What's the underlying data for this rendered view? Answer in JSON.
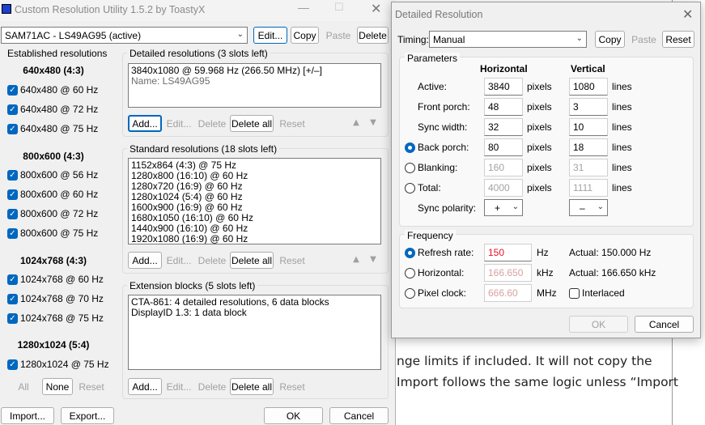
{
  "main": {
    "title": "Custom Resolution Utility 1.5.2 by ToastyX",
    "monitor": "SAM71AC - LS49AG95 (active)",
    "buttons": {
      "edit": "Edit...",
      "copy": "Copy",
      "paste": "Paste",
      "delete": "Delete"
    },
    "established": {
      "title": "Established resolutions",
      "groups": [
        {
          "header": "640x480 (4:3)",
          "items": [
            "640x480 @ 60 Hz",
            "640x480 @ 72 Hz",
            "640x480 @ 75 Hz"
          ]
        },
        {
          "header": "800x600 (4:3)",
          "items": [
            "800x600 @ 56 Hz",
            "800x600 @ 60 Hz",
            "800x600 @ 72 Hz",
            "800x600 @ 75 Hz"
          ]
        },
        {
          "header": "1024x768 (4:3)",
          "items": [
            "1024x768 @ 60 Hz",
            "1024x768 @ 70 Hz",
            "1024x768 @ 75 Hz"
          ]
        },
        {
          "header": "1280x1024 (5:4)",
          "items": [
            "1280x1024 @ 75 Hz"
          ]
        }
      ],
      "buttons": {
        "all": "All",
        "none": "None",
        "reset": "Reset"
      }
    },
    "detailed": {
      "title": "Detailed resolutions (3 slots left)",
      "entry": "3840x1080 @ 59.968 Hz (266.50 MHz) [+/–]",
      "name": "Name: LS49AG95"
    },
    "standard": {
      "title": "Standard resolutions (18 slots left)",
      "items": [
        "1152x864 (4:3) @ 75 Hz",
        "1280x800 (16:10) @ 60 Hz",
        "1280x720 (16:9) @ 60 Hz",
        "1280x1024 (5:4) @ 60 Hz",
        "1600x900 (16:9) @ 60 Hz",
        "1680x1050 (16:10) @ 60 Hz",
        "1440x900 (16:10) @ 60 Hz",
        "1920x1080 (16:9) @ 60 Hz"
      ]
    },
    "extension": {
      "title": "Extension blocks (5 slots left)",
      "items": [
        "CTA-861: 4 detailed resolutions, 6 data blocks",
        "DisplayID 1.3: 1 data block"
      ]
    },
    "listbuttons": {
      "add": "Add...",
      "edit": "Edit...",
      "delete": "Delete",
      "deleteall": "Delete all",
      "reset": "Reset"
    },
    "bottom": {
      "import": "Import...",
      "export": "Export...",
      "ok": "OK",
      "cancel": "Cancel"
    }
  },
  "detail": {
    "title": "Detailed Resolution",
    "timing_label": "Timing:",
    "timing_value": "Manual",
    "buttons": {
      "copy": "Copy",
      "paste": "Paste",
      "reset": "Reset"
    },
    "params_title": "Parameters",
    "col_h": "Horizontal",
    "col_v": "Vertical",
    "rows": [
      {
        "label": "Active:",
        "h": "3840",
        "v": "1080"
      },
      {
        "label": "Front porch:",
        "h": "48",
        "v": "3"
      },
      {
        "label": "Sync width:",
        "h": "32",
        "v": "10"
      },
      {
        "label": "Back porch:",
        "h": "80",
        "v": "18"
      },
      {
        "label": "Blanking:",
        "h": "160",
        "v": "31"
      },
      {
        "label": "Total:",
        "h": "4000",
        "v": "1111"
      }
    ],
    "unit_h": "pixels",
    "unit_v": "lines",
    "sync_label": "Sync polarity:",
    "sync_h": "+",
    "sync_v": "–",
    "freq_title": "Frequency",
    "refresh_label": "Refresh rate:",
    "refresh_value": "150",
    "refresh_unit": "Hz",
    "refresh_actual": "Actual: 150.000 Hz",
    "horiz_label": "Horizontal:",
    "horiz_value": "166.650",
    "horiz_unit": "kHz",
    "horiz_actual": "Actual: 166.650 kHz",
    "pclk_label": "Pixel clock:",
    "pclk_value": "666.60",
    "pclk_unit": "MHz",
    "interlaced": "Interlaced",
    "ok": "OK",
    "cancel": "Cancel"
  },
  "background_text": {
    "line1": "nge limits if included. It will not copy the",
    "line2": "Import follows the same logic unless “Import"
  }
}
